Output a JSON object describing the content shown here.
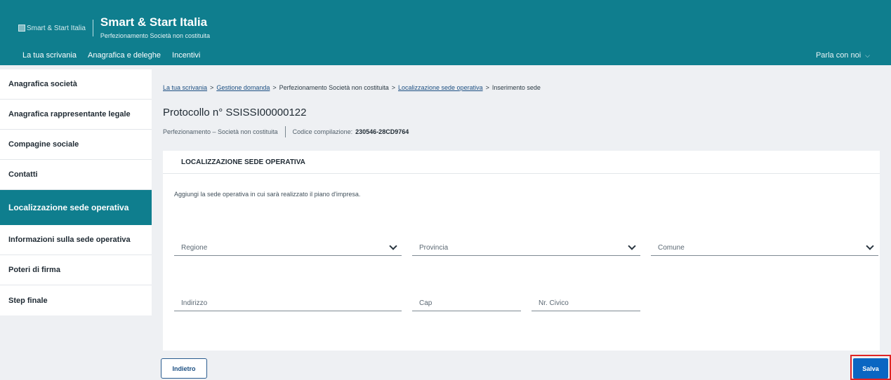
{
  "header": {
    "logo_alt": "Smart & Start Italia",
    "title": "Smart & Start Italia",
    "subtitle": "Perfezionamento Società non costituita",
    "nav": [
      "La tua scrivania",
      "Anagrafica e deleghe",
      "Incentivi"
    ],
    "contact": "Parla con noi"
  },
  "sidebar": {
    "items": [
      {
        "label": "Anagrafica società"
      },
      {
        "label": "Anagrafica rappresentante legale"
      },
      {
        "label": "Compagine sociale"
      },
      {
        "label": "Contatti"
      },
      {
        "label": "Localizzazione sede operativa",
        "active": true
      },
      {
        "label": "Informazioni sulla sede operativa"
      },
      {
        "label": "Poteri di firma"
      },
      {
        "label": "Step finale"
      }
    ]
  },
  "breadcrumb": {
    "items": [
      {
        "label": "La tua scrivania",
        "link": true
      },
      {
        "label": "Gestione domanda",
        "link": true
      },
      {
        "label": "Perfezionamento Società non costituita",
        "link": false
      },
      {
        "label": "Localizzazione sede operativa",
        "link": true
      },
      {
        "label": "Inserimento sede",
        "link": false
      }
    ],
    "separator": ">"
  },
  "protocol": {
    "title": "Protocollo n° SSISSI00000122",
    "type": "Perfezionamento  –  Società non costituita",
    "code_label": "Codice compilazione:",
    "code_value": "230546-28CD9764"
  },
  "card": {
    "title": "LOCALIZZAZIONE SEDE OPERATIVA",
    "description": "Aggiungi la sede operativa in cui sarà realizzato il piano d'impresa.",
    "fields": {
      "regione": "Regione",
      "provincia": "Provincia",
      "comune": "Comune",
      "indirizzo": "Indirizzo",
      "cap": "Cap",
      "civico": "Nr. Civico"
    }
  },
  "actions": {
    "back": "Indietro",
    "save": "Salva"
  },
  "colors": {
    "primary": "#0f7e8e",
    "button_blue": "#0a66c2",
    "highlight": "#e02424"
  }
}
